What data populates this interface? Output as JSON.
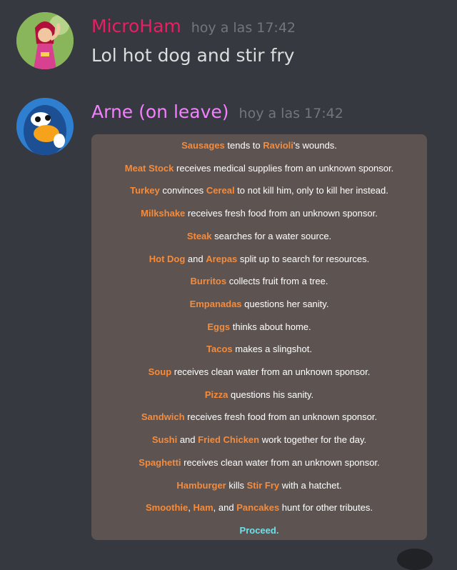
{
  "messages": [
    {
      "username": "MicroHam",
      "username_color": "#e91e63",
      "timestamp": "hoy a las 17:42",
      "text": "Lol hot dog and stir fry",
      "avatar_icon": "avatar-hercules-character"
    },
    {
      "username": "Arne (on leave)",
      "username_color": "#f47fff",
      "timestamp": "hoy a las 17:42",
      "avatar_icon": "avatar-penguin-character"
    }
  ],
  "embed": {
    "lines": [
      [
        [
          "Sausages",
          true
        ],
        [
          " tends to ",
          false
        ],
        [
          "Ravioli",
          true
        ],
        [
          "'s wounds.",
          false
        ]
      ],
      [
        [
          "Meat Stock",
          true
        ],
        [
          " receives medical supplies from an unknown sponsor.",
          false
        ]
      ],
      [
        [
          "Turkey",
          true
        ],
        [
          " convinces ",
          false
        ],
        [
          "Cereal",
          true
        ],
        [
          " to not kill him, only to kill her instead.",
          false
        ]
      ],
      [
        [
          "Milkshake",
          true
        ],
        [
          " receives fresh food from an unknown sponsor.",
          false
        ]
      ],
      [
        [
          "Steak",
          true
        ],
        [
          " searches for a water source.",
          false
        ]
      ],
      [
        [
          "Hot Dog",
          true
        ],
        [
          " and ",
          false
        ],
        [
          "Arepas",
          true
        ],
        [
          " split up to search for resources.",
          false
        ]
      ],
      [
        [
          "Burritos",
          true
        ],
        [
          " collects fruit from a tree.",
          false
        ]
      ],
      [
        [
          "Empanadas",
          true
        ],
        [
          " questions her sanity.",
          false
        ]
      ],
      [
        [
          "Eggs",
          true
        ],
        [
          " thinks about home.",
          false
        ]
      ],
      [
        [
          "Tacos",
          true
        ],
        [
          " makes a slingshot.",
          false
        ]
      ],
      [
        [
          "Soup",
          true
        ],
        [
          " receives clean water from an unknown sponsor.",
          false
        ]
      ],
      [
        [
          "Pizza",
          true
        ],
        [
          " questions his sanity.",
          false
        ]
      ],
      [
        [
          "Sandwich",
          true
        ],
        [
          " receives fresh food from an unknown sponsor.",
          false
        ]
      ],
      [
        [
          "Sushi",
          true
        ],
        [
          " and ",
          false
        ],
        [
          "Fried Chicken",
          true
        ],
        [
          " work together for the day.",
          false
        ]
      ],
      [
        [
          "Spaghetti",
          true
        ],
        [
          " receives clean water from an unknown sponsor.",
          false
        ]
      ],
      [
        [
          "Hamburger",
          true
        ],
        [
          " kills ",
          false
        ],
        [
          "Stir Fry",
          true
        ],
        [
          " with a hatchet.",
          false
        ]
      ],
      [
        [
          "Smoothie",
          true
        ],
        [
          ", ",
          false
        ],
        [
          "Ham",
          true
        ],
        [
          ", and ",
          false
        ],
        [
          "Pancakes",
          true
        ],
        [
          " hunt for other tributes.",
          false
        ]
      ]
    ],
    "proceed_label": "Proceed.",
    "highlight_color": "#f58b3b",
    "proceed_color": "#6fe0ea",
    "background_color": "#5d5452"
  }
}
